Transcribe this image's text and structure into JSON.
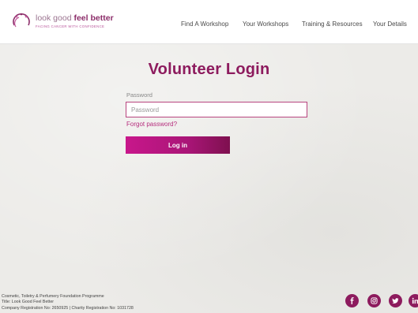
{
  "header": {
    "logo": {
      "text_light": "look good",
      "text_bold": "feel better",
      "tagline": "FACING CANCER WITH CONFIDENCE"
    },
    "nav": [
      "Find A Workshop",
      "Your Workshops",
      "Training & Resources",
      "Your Details"
    ]
  },
  "main": {
    "title": "Volunteer Login",
    "password_label": "Password",
    "password_placeholder": "Password",
    "forgot_link": "Forgot password?",
    "login_button": "Log in"
  },
  "footer": {
    "lines": [
      "Cosmetic, Toiletry & Perfumery Foundation Programme",
      "Title: Look Good Feel Better",
      "Company Registration No: 2650925 | Charity Registration No: 1031728"
    ],
    "social_icons": [
      "facebook-icon",
      "instagram-icon",
      "twitter-icon",
      "linkedin-icon"
    ]
  },
  "colors": {
    "brand": "#8d1b5e",
    "accent": "#c8178b"
  }
}
